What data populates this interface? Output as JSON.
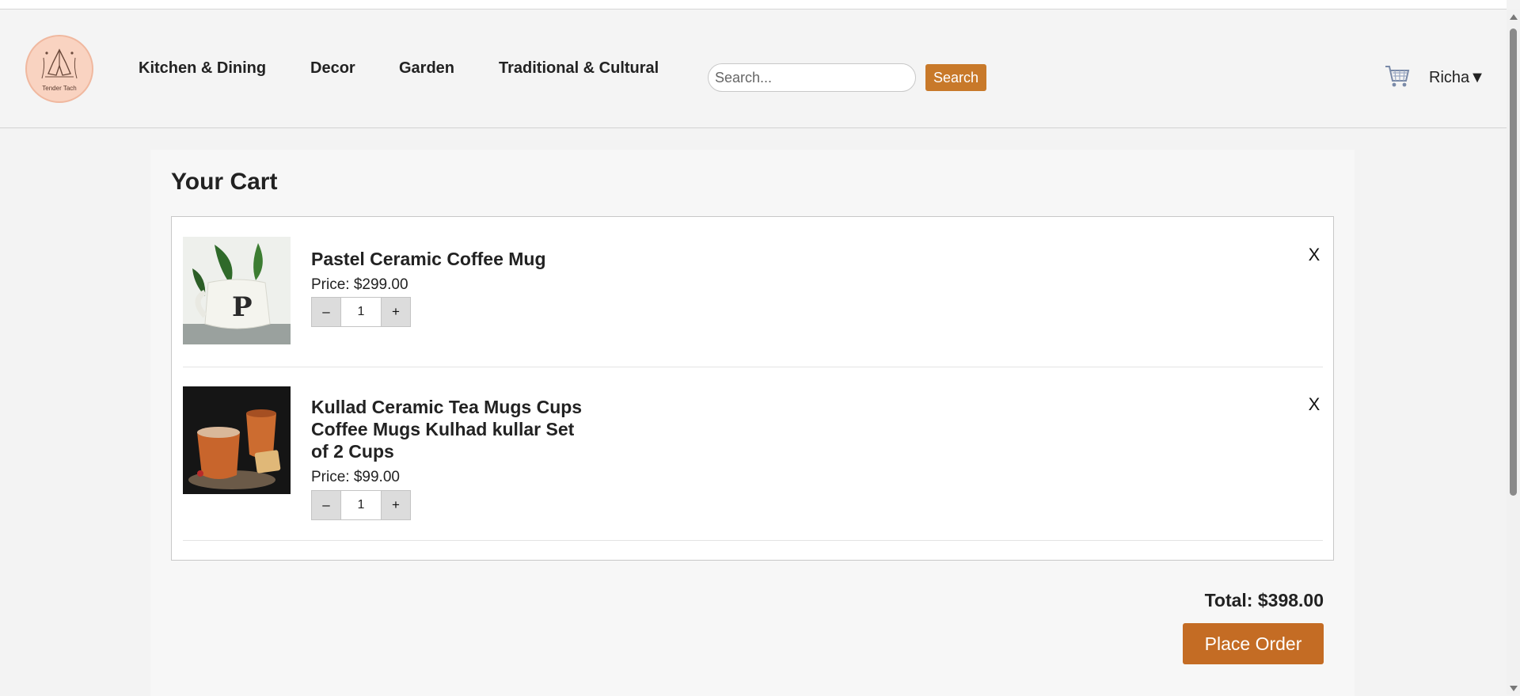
{
  "header": {
    "logo_text": "Tender Tach",
    "nav": [
      "Kitchen & Dining",
      "Decor",
      "Garden",
      "Traditional & Cultural"
    ],
    "search": {
      "placeholder": "Search...",
      "value": "",
      "button_label": "Search"
    },
    "user_label": "Richa▼",
    "icons": {
      "cart": "shopping-cart-icon",
      "logo": "praying-hands-logo"
    }
  },
  "cart": {
    "title": "Your Cart",
    "items": [
      {
        "name": "Pastel Ceramic Coffee Mug",
        "price": "Price: $299.00",
        "quantity": "1",
        "remove_label": "X"
      },
      {
        "name": "Kullad Ceramic Tea Mugs Cups Coffee Mugs Kulhad kullar Set of 2 Cups",
        "price": "Price: $99.00",
        "quantity": "1",
        "remove_label": "X"
      }
    ],
    "qty_minus_label": "–",
    "qty_plus_label": "+",
    "total": "Total: $398.00",
    "place_order_label": "Place Order"
  },
  "colors": {
    "accent": "#c8792a",
    "place_order": "#c46c24",
    "logo_bg": "#f9d3c1"
  }
}
